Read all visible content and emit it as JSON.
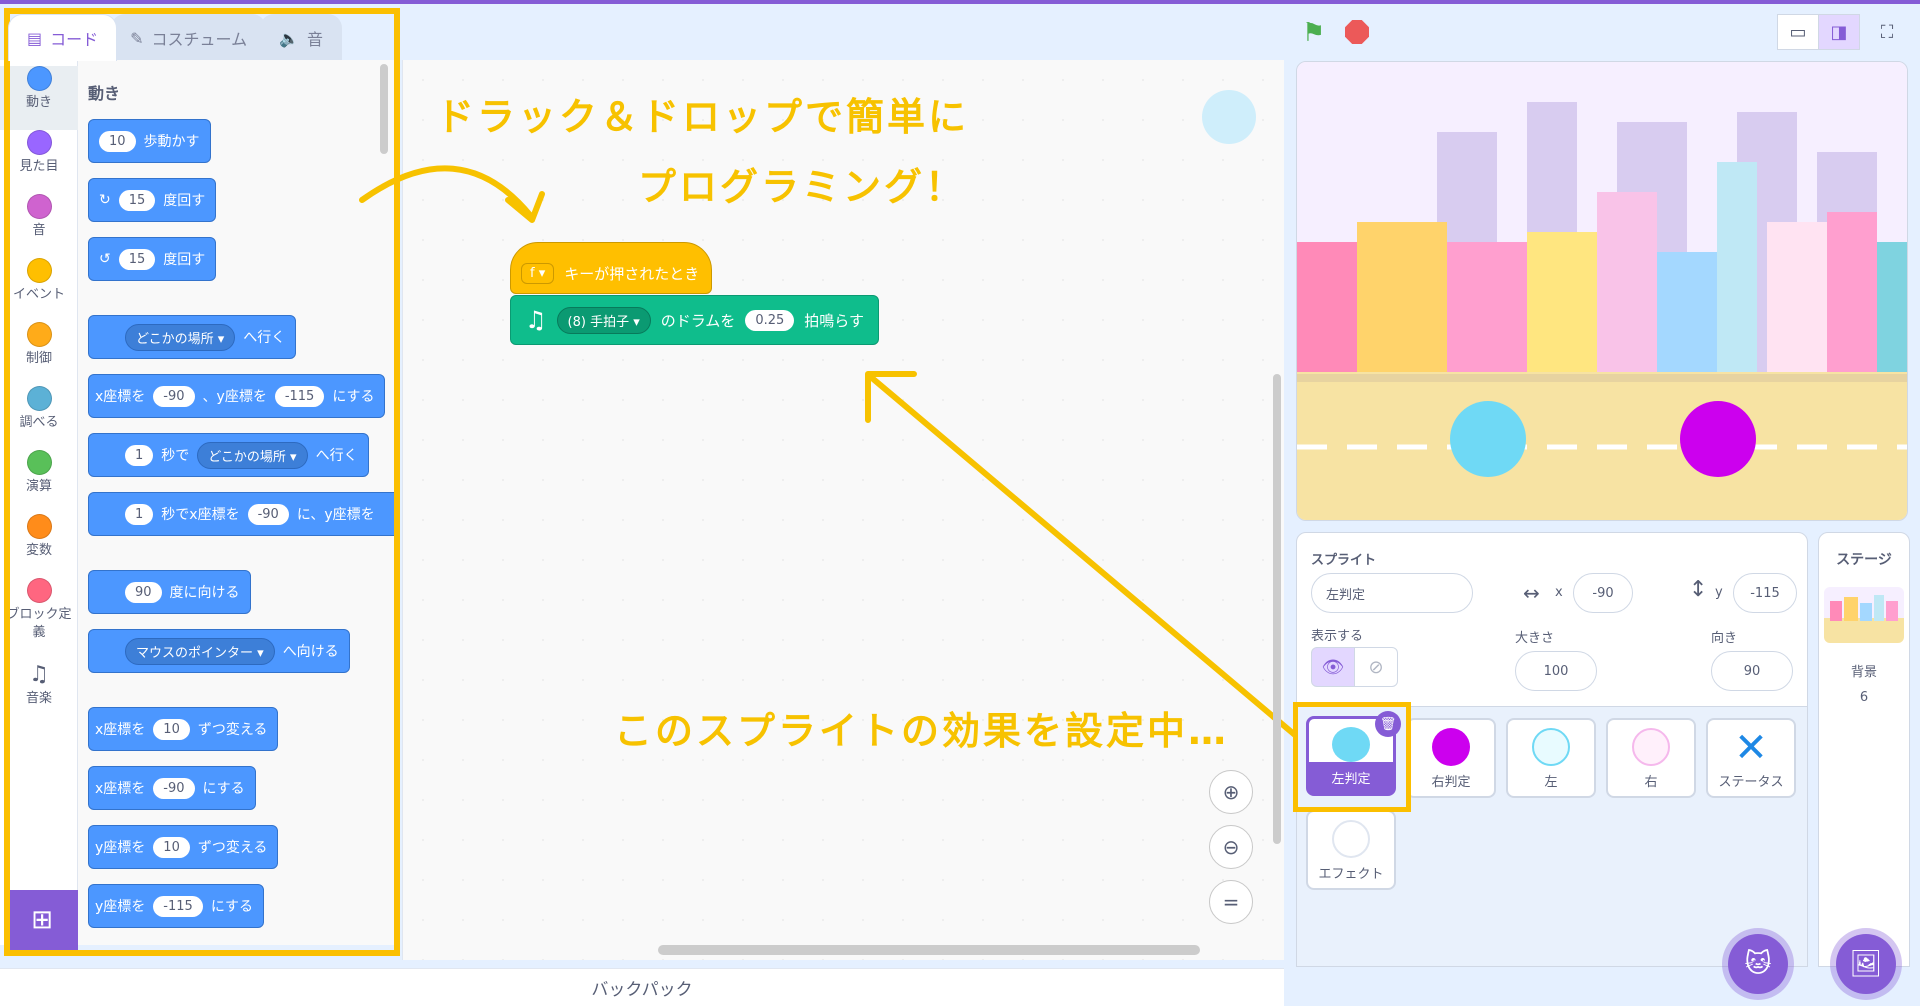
{
  "tabs": [
    {
      "label": "コード",
      "icon": "code-icon"
    },
    {
      "label": "コスチューム",
      "icon": "brush-icon"
    },
    {
      "label": "音",
      "icon": "speaker-icon"
    }
  ],
  "categories": [
    {
      "label": "動き",
      "color": "#4c97ff"
    },
    {
      "label": "見た目",
      "color": "#9966ff"
    },
    {
      "label": "音",
      "color": "#cf63cf"
    },
    {
      "label": "イベント",
      "color": "#ffbf00"
    },
    {
      "label": "制御",
      "color": "#ffab19"
    },
    {
      "label": "調べる",
      "color": "#5cb1d6"
    },
    {
      "label": "演算",
      "color": "#59c059"
    },
    {
      "label": "変数",
      "color": "#ff8c1a"
    },
    {
      "label": "ブロック定義",
      "color": "#ff6680"
    },
    {
      "label": "音楽",
      "color": "#0fbd8c"
    }
  ],
  "palette": {
    "title": "動き",
    "blocks": {
      "move": {
        "value": "10",
        "text": "歩動かす"
      },
      "turn_right": {
        "value": "15",
        "text": "度回す"
      },
      "turn_left": {
        "value": "15",
        "text": "度回す"
      },
      "goto": {
        "dropdown": "どこかの場所",
        "text": "へ行く"
      },
      "gotoxy": {
        "t1": "x座標を",
        "x": "-90",
        "t2": "、y座標を",
        "y": "-115",
        "t3": "にする"
      },
      "glide": {
        "value": "1",
        "t1": "秒で",
        "dropdown": "どこかの場所",
        "t2": "へ行く"
      },
      "glidexy": {
        "value": "1",
        "t1": "秒でx座標を",
        "x": "-90",
        "t2": "に、y座標を"
      },
      "point": {
        "value": "90",
        "text": "度に向ける"
      },
      "pointto": {
        "dropdown": "マウスのポインター",
        "text": "へ向ける"
      },
      "changex": {
        "t1": "x座標を",
        "value": "10",
        "t2": "ずつ変える"
      },
      "setx": {
        "t1": "x座標を",
        "value": "-90",
        "t2": "にする"
      },
      "changey": {
        "t1": "y座標を",
        "value": "10",
        "t2": "ずつ変える"
      },
      "sety": {
        "t1": "y座標を",
        "value": "-115",
        "t2": "にする"
      }
    }
  },
  "script": {
    "hat": {
      "key": "f",
      "text": "キーが押されたとき"
    },
    "drum": {
      "dropdown": "(8) 手拍子",
      "t1": "のドラムを",
      "value": "0.25",
      "t2": "拍鳴らす"
    }
  },
  "annotations": {
    "line1": "ドラック＆ドロップで簡単に",
    "line2": "プログラミング！",
    "line3": "このスプライトの効果を設定中…"
  },
  "backpack": "バックパック",
  "sprite_info": {
    "label": "スプライト",
    "name": "左判定",
    "x_label": "x",
    "x": "-90",
    "y_label": "y",
    "y": "-115",
    "show_label": "表示する",
    "size_label": "大きさ",
    "size": "100",
    "direction_label": "向き",
    "direction": "90"
  },
  "sprites": [
    {
      "name": "左判定",
      "color": "#6fd9f5",
      "selected": true
    },
    {
      "name": "右判定",
      "color": "#cc00ee",
      "selected": false
    },
    {
      "name": "左",
      "color": "#e8fbff",
      "selected": false
    },
    {
      "name": "右",
      "color": "#fff0fb",
      "selected": false
    },
    {
      "name": "ステータス",
      "color": "#1e88e5",
      "selected": false
    },
    {
      "name": "エフェクト",
      "color": "#ffffff",
      "selected": false
    }
  ],
  "stage_panel": {
    "title": "ステージ",
    "backdrop_label": "背景",
    "backdrop_count": "6"
  },
  "stage_sprites": {
    "left_color": "#6fd9f5",
    "right_color": "#cc00ee"
  },
  "colors": {
    "accent": "#855cd6",
    "highlight": "#fbbf00"
  }
}
